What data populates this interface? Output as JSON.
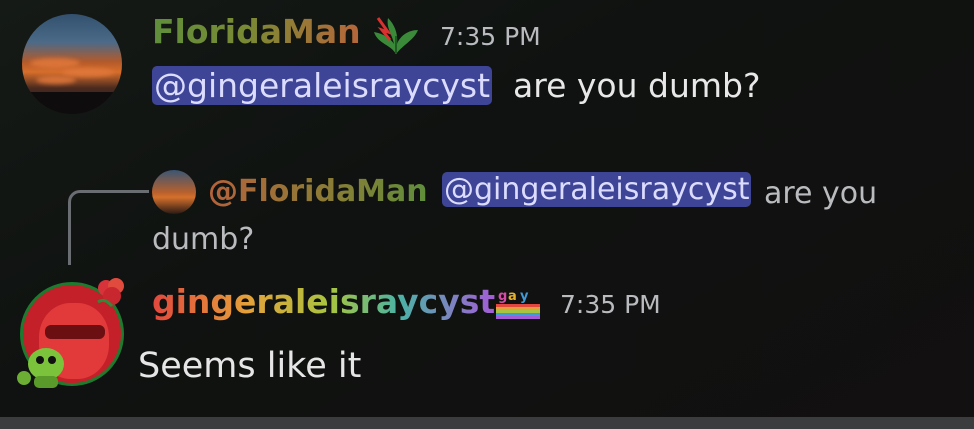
{
  "messages": [
    {
      "author": "FloridaMan",
      "timestamp": "7:35 PM",
      "role_icon": "leaf-icon",
      "mention": "@gingeraleisraycyst",
      "text": "are you dumb?"
    },
    {
      "author": "gingeraleisraycyst",
      "timestamp": "7:35 PM",
      "role_icon": "gay-rainbow-icon",
      "text": "Seems like it",
      "reply": {
        "author": "@FloridaMan",
        "mention": "@gingeraleisraycyst",
        "text_line1": "are you",
        "text_line2": "dumb?"
      }
    }
  ],
  "colors": {
    "mention_bg": "#3e4596",
    "mention_text": "#dbdcff",
    "timestamp": "#b9bbbe",
    "background": "#0d0f0d"
  }
}
